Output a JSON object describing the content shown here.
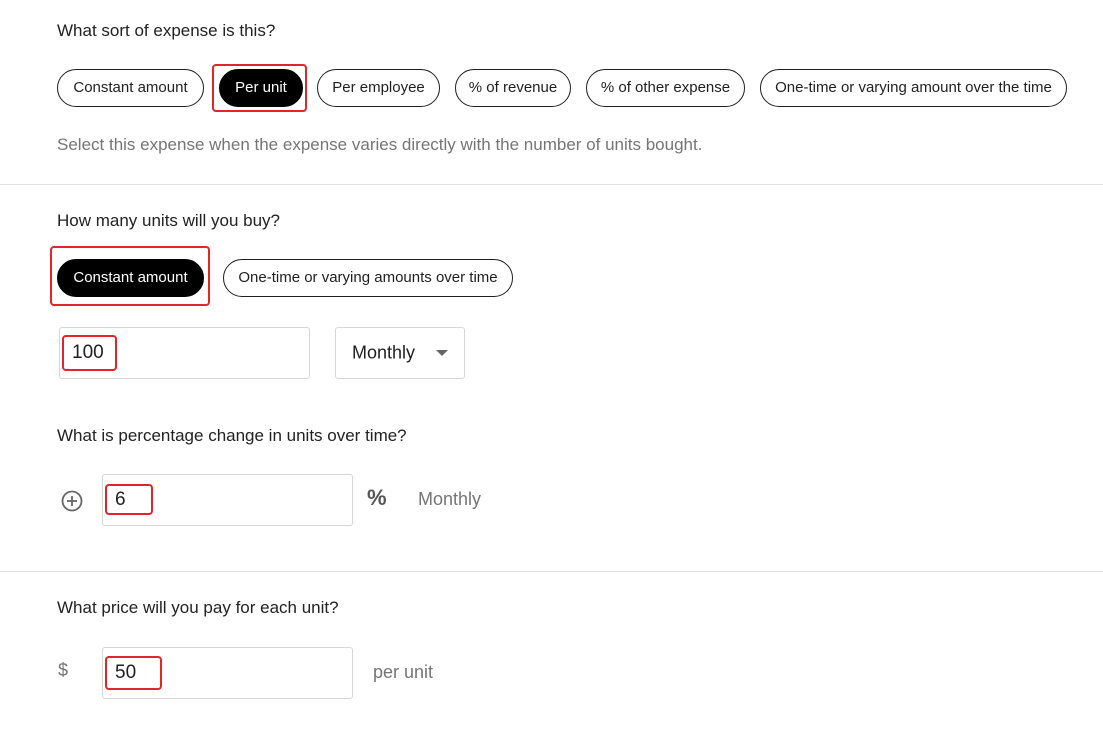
{
  "expense_type": {
    "question": "What sort of expense is this?",
    "options": [
      "Constant amount",
      "Per unit",
      "Per employee",
      "% of revenue",
      "% of other expense",
      "One-time or varying amount over the time"
    ],
    "selected_index": 1,
    "description": "Select this expense when the expense varies directly with the number of units bought."
  },
  "units": {
    "question": "How many units will you buy?",
    "options": [
      "Constant amount",
      "One-time or varying amounts over time"
    ],
    "selected_index": 0,
    "amount_value": "100",
    "frequency": "Monthly"
  },
  "change": {
    "question": "What is percentage change in units over time?",
    "value": "6",
    "unit_symbol": "%",
    "frequency": "Monthly"
  },
  "price": {
    "question": "What price will you pay for each unit?",
    "currency": "$",
    "value": "50",
    "suffix": "per unit"
  },
  "icons": {
    "plus": "plus-circle-icon",
    "percent": "percent-icon",
    "dropdown": "caret-down-icon"
  },
  "colors": {
    "highlight": "#e3242b",
    "active_pill": "#000000"
  }
}
